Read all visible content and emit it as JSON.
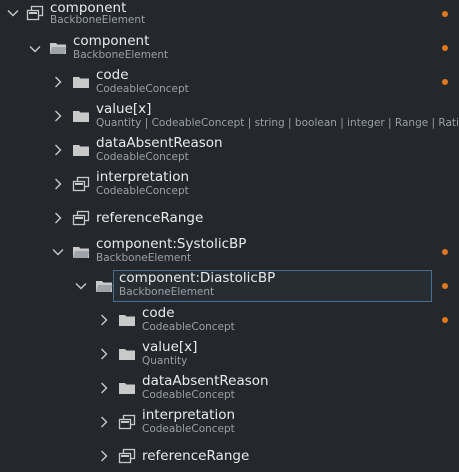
{
  "colors": {
    "background": "#24282d",
    "text": "#eaeaea",
    "muted": "#9aa0a6",
    "modified_dot": "#e0771e",
    "selection_border": "#4a6f8a"
  },
  "rows": [
    {
      "name": "component",
      "type": "BackboneElement",
      "icon": "complex-type-icon",
      "expanded": true,
      "modified": true
    },
    {
      "name": "component",
      "type": "BackboneElement",
      "icon": "folder-icon",
      "expanded": true,
      "modified": true
    },
    {
      "name": "code",
      "type": "CodeableConcept",
      "icon": "folder-icon",
      "expanded": false,
      "modified": true
    },
    {
      "name": "value[x]",
      "type": "Quantity | CodeableConcept | string | boolean | integer | Range | Ratio | S",
      "icon": "folder-icon",
      "expanded": false,
      "modified": false
    },
    {
      "name": "dataAbsentReason",
      "type": "CodeableConcept",
      "icon": "folder-icon",
      "expanded": false,
      "modified": false
    },
    {
      "name": "interpretation",
      "type": "CodeableConcept",
      "icon": "complex-type-icon",
      "expanded": false,
      "modified": false
    },
    {
      "name": "referenceRange",
      "type": "",
      "icon": "complex-type-icon",
      "expanded": false,
      "modified": false
    },
    {
      "name": "component:SystolicBP",
      "type": "BackboneElement",
      "icon": "folder-icon",
      "expanded": true,
      "modified": true
    },
    {
      "name": "component:DiastolicBP",
      "type": "BackboneElement",
      "icon": "folder-icon",
      "expanded": true,
      "modified": true,
      "selected": true
    },
    {
      "name": "code",
      "type": "CodeableConcept",
      "icon": "folder-icon",
      "expanded": false,
      "modified": true
    },
    {
      "name": "value[x]",
      "type": "Quantity",
      "icon": "folder-icon",
      "expanded": false,
      "modified": false
    },
    {
      "name": "dataAbsentReason",
      "type": "CodeableConcept",
      "icon": "folder-icon",
      "expanded": false,
      "modified": false
    },
    {
      "name": "interpretation",
      "type": "CodeableConcept",
      "icon": "complex-type-icon",
      "expanded": false,
      "modified": false
    },
    {
      "name": "referenceRange",
      "type": "",
      "icon": "complex-type-icon",
      "expanded": false,
      "modified": false
    }
  ]
}
